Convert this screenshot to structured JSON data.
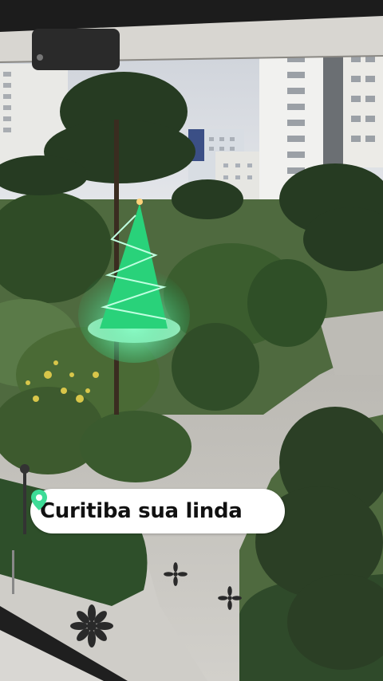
{
  "caption": {
    "text": "Curitiba sua linda",
    "icon": "location-pin-icon",
    "icon_color": "#3ddc97"
  }
}
